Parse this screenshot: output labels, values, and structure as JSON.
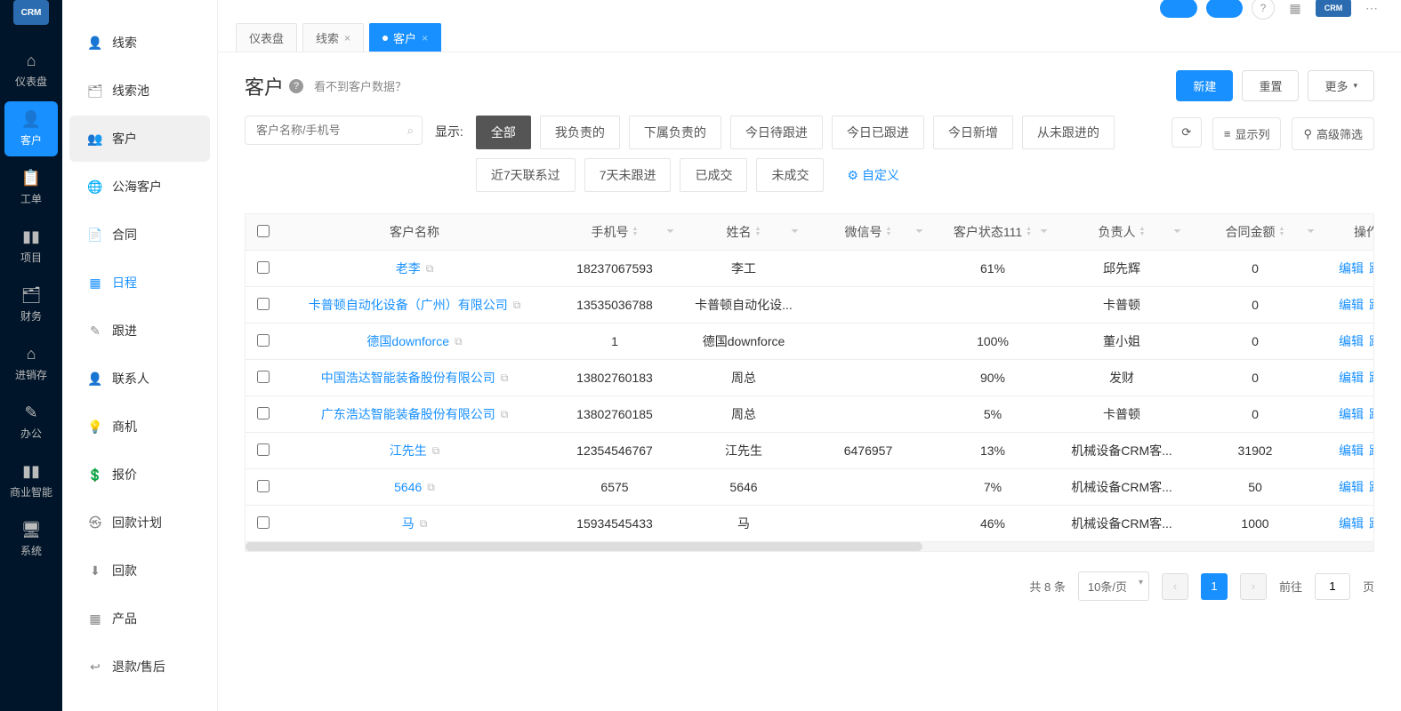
{
  "mainNav": [
    {
      "label": "仪表盘",
      "icon": "⌂"
    },
    {
      "label": "客户",
      "icon": "👤",
      "active": true
    },
    {
      "label": "工单",
      "icon": "📋"
    },
    {
      "label": "项目",
      "icon": "▮▮"
    },
    {
      "label": "财务",
      "icon": "🗂"
    },
    {
      "label": "进销存",
      "icon": "⌂"
    },
    {
      "label": "办公",
      "icon": "✎"
    },
    {
      "label": "商业智能",
      "icon": "▮▮"
    },
    {
      "label": "系统",
      "icon": "🖥"
    }
  ],
  "subNav": [
    {
      "label": "线索",
      "icon": "lead"
    },
    {
      "label": "线索池",
      "icon": "pool"
    },
    {
      "label": "客户",
      "icon": "customer",
      "active": true
    },
    {
      "label": "公海客户",
      "icon": "public"
    },
    {
      "label": "合同",
      "icon": "contract"
    },
    {
      "label": "日程",
      "icon": "calendar",
      "highlighted": true
    },
    {
      "label": "跟进",
      "icon": "follow"
    },
    {
      "label": "联系人",
      "icon": "contact"
    },
    {
      "label": "商机",
      "icon": "opportunity"
    },
    {
      "label": "报价",
      "icon": "quote"
    },
    {
      "label": "回款计划",
      "icon": "payplan"
    },
    {
      "label": "回款",
      "icon": "payment"
    },
    {
      "label": "产品",
      "icon": "product"
    },
    {
      "label": "退款/售后",
      "icon": "refund"
    }
  ],
  "tabs": [
    {
      "label": "仪表盘"
    },
    {
      "label": "线索",
      "closable": true
    },
    {
      "label": "客户",
      "closable": true,
      "active": true
    }
  ],
  "page": {
    "title": "客户",
    "help": "?",
    "subtitle": "看不到客户数据？",
    "newBtn": "新建",
    "resetBtn": "重置",
    "moreBtn": "更多"
  },
  "search": {
    "placeholder": "客户名称/手机号"
  },
  "showLabel": "显示:",
  "filters": [
    {
      "label": "全部",
      "active": true
    },
    {
      "label": "我负责的"
    },
    {
      "label": "下属负责的"
    },
    {
      "label": "今日待跟进"
    },
    {
      "label": "今日已跟进"
    },
    {
      "label": "今日新增"
    },
    {
      "label": "从未跟进的"
    },
    {
      "label": "近7天联系过"
    },
    {
      "label": "7天未跟进"
    },
    {
      "label": "已成交"
    },
    {
      "label": "未成交"
    }
  ],
  "customFilter": "自定义",
  "toolButtons": {
    "showCols": "显示列",
    "advanced": "高级筛选"
  },
  "columns": [
    "",
    "客户名称",
    "手机号",
    "姓名",
    "微信号",
    "客户状态111",
    "负责人",
    "合同金额",
    "操作"
  ],
  "rows": [
    {
      "name": "老李",
      "phone": "18237067593",
      "contact": "李工",
      "wechat": "",
      "status": "61%",
      "owner": "邱先辉",
      "amount": "0"
    },
    {
      "name": "卡普顿自动化设备（广州）有限公司",
      "phone": "13535036788",
      "contact": "卡普顿自动化设...",
      "wechat": "",
      "status": "",
      "owner": "卡普顿",
      "amount": "0"
    },
    {
      "name": "德国downforce",
      "phone": "1",
      "contact": "德国downforce",
      "wechat": "",
      "status": "100%",
      "owner": "董小姐",
      "amount": "0"
    },
    {
      "name": "中国浩达智能装备股份有限公司",
      "phone": "13802760183",
      "contact": "周总",
      "wechat": "",
      "status": "90%",
      "owner": "发财",
      "amount": "0"
    },
    {
      "name": "广东浩达智能装备股份有限公司",
      "phone": "13802760185",
      "contact": "周总",
      "wechat": "",
      "status": "5%",
      "owner": "卡普顿",
      "amount": "0"
    },
    {
      "name": "江先生",
      "phone": "12354546767",
      "contact": "江先生",
      "wechat": "6476957",
      "status": "13%",
      "owner": "机械设备CRM客...",
      "amount": "31902"
    },
    {
      "name": "5646",
      "phone": "6575",
      "contact": "5646",
      "wechat": "",
      "status": "7%",
      "owner": "机械设备CRM客...",
      "amount": "50"
    },
    {
      "name": "马",
      "phone": "15934545433",
      "contact": "马",
      "wechat": "",
      "status": "46%",
      "owner": "机械设备CRM客...",
      "amount": "1000"
    }
  ],
  "rowActions": {
    "edit": "编辑",
    "follow": "跟进"
  },
  "pagination": {
    "total": "共 8 条",
    "pageSize": "10条/页",
    "current": "1",
    "goto": "前往",
    "gotoVal": "1",
    "pageSuffix": "页"
  },
  "logoText": "CRM"
}
